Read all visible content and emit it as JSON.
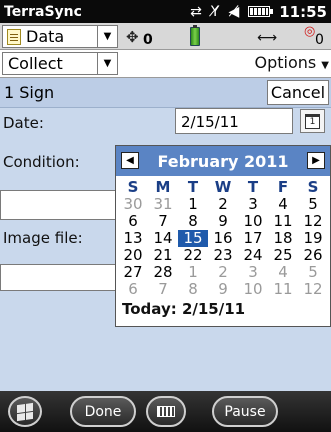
{
  "status_bar": {
    "app_title": "TerraSync",
    "time": "11:55",
    "icons": [
      "sync-arrows-icon",
      "signal-no-service-icon",
      "volume-icon",
      "battery-icon"
    ]
  },
  "toolbar": {
    "data_label": "Data",
    "satellite_count": "0",
    "gnss_count": "0",
    "collect_label": "Collect",
    "options_label": "Options"
  },
  "form": {
    "title": "1 Sign",
    "cancel_label": "Cancel",
    "date_label": "Date:",
    "date_value": "2/15/11",
    "condition_label": "Condition:",
    "image_label": "Image file:"
  },
  "calendar": {
    "month": "February 2011",
    "days_of_week": [
      "S",
      "M",
      "T",
      "W",
      "T",
      "F",
      "S"
    ],
    "weeks": [
      [
        {
          "d": "30",
          "m": true
        },
        {
          "d": "31",
          "m": true
        },
        {
          "d": "1"
        },
        {
          "d": "2"
        },
        {
          "d": "3"
        },
        {
          "d": "4"
        },
        {
          "d": "5"
        }
      ],
      [
        {
          "d": "6"
        },
        {
          "d": "7"
        },
        {
          "d": "8"
        },
        {
          "d": "9"
        },
        {
          "d": "10"
        },
        {
          "d": "11"
        },
        {
          "d": "12"
        }
      ],
      [
        {
          "d": "13"
        },
        {
          "d": "14"
        },
        {
          "d": "15",
          "s": true
        },
        {
          "d": "16"
        },
        {
          "d": "17"
        },
        {
          "d": "18"
        },
        {
          "d": "19"
        }
      ],
      [
        {
          "d": "20"
        },
        {
          "d": "21"
        },
        {
          "d": "22"
        },
        {
          "d": "23"
        },
        {
          "d": "24"
        },
        {
          "d": "25"
        },
        {
          "d": "26"
        }
      ],
      [
        {
          "d": "27"
        },
        {
          "d": "28"
        },
        {
          "d": "1",
          "m": true
        },
        {
          "d": "2",
          "m": true
        },
        {
          "d": "3",
          "m": true
        },
        {
          "d": "4",
          "m": true
        },
        {
          "d": "5",
          "m": true
        }
      ],
      [
        {
          "d": "6",
          "m": true
        },
        {
          "d": "7",
          "m": true
        },
        {
          "d": "8",
          "m": true
        },
        {
          "d": "9",
          "m": true
        },
        {
          "d": "10",
          "m": true
        },
        {
          "d": "11",
          "m": true
        },
        {
          "d": "12",
          "m": true
        }
      ]
    ],
    "today_label": "Today: 2/15/11",
    "colors": {
      "header": "#5a84c4",
      "selected": "#1f5aab",
      "day_of_week": "#1a3e86"
    }
  },
  "bottom_bar": {
    "done_label": "Done",
    "pause_label": "Pause"
  }
}
